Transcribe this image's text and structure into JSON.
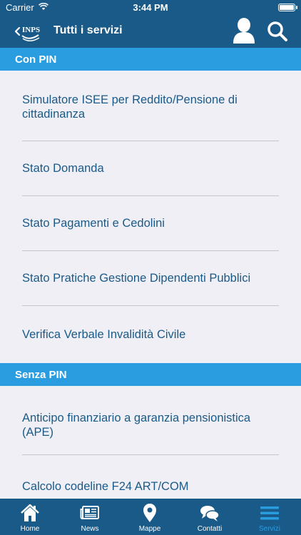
{
  "status_bar": {
    "carrier": "Carrier",
    "time": "3:44 PM"
  },
  "nav": {
    "back_logo": "INPS",
    "title": "Tutti i servizi"
  },
  "sections": [
    {
      "title": "Con PIN",
      "items": [
        "Simulatore ISEE per Reddito/Pensione di cittadinanza",
        "Stato Domanda",
        "Stato Pagamenti e Cedolini",
        "Stato Pratiche Gestione Dipendenti Pubblici",
        "Verifica Verbale Invalidità Civile"
      ]
    },
    {
      "title": "Senza PIN",
      "items": [
        "Anticipo finanziario a garanzia pensionistica (APE)",
        "Calcolo codeline F24 ART/COM"
      ]
    }
  ],
  "tabs": [
    {
      "label": "Home",
      "icon": "home-icon",
      "active": false
    },
    {
      "label": "News",
      "icon": "news-icon",
      "active": false
    },
    {
      "label": "Mappe",
      "icon": "map-pin-icon",
      "active": false
    },
    {
      "label": "Contatti",
      "icon": "chat-bubbles-icon",
      "active": false
    },
    {
      "label": "Servizi",
      "icon": "menu-icon",
      "active": true
    }
  ],
  "colors": {
    "navbar": "#1a5a88",
    "section_header": "#2a9de0",
    "item_text": "#1a5a88",
    "background": "#f0eff5",
    "active_tab": "#2a9de0"
  }
}
